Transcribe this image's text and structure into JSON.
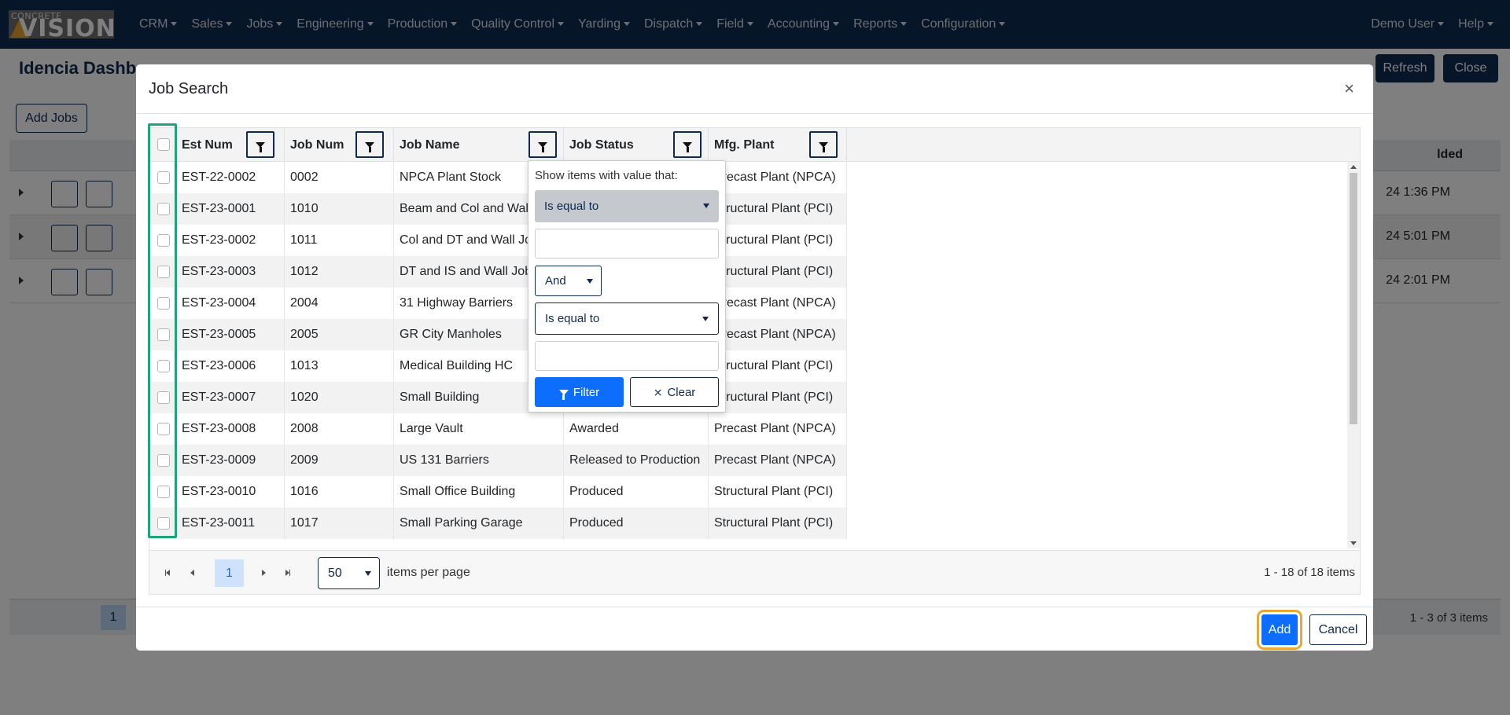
{
  "app": {
    "logo_small": "CONCRETE",
    "logo_big": "VISION"
  },
  "nav": {
    "items": [
      {
        "label": "CRM"
      },
      {
        "label": "Sales"
      },
      {
        "label": "Jobs"
      },
      {
        "label": "Engineering"
      },
      {
        "label": "Production"
      },
      {
        "label": "Quality Control"
      },
      {
        "label": "Yarding"
      },
      {
        "label": "Dispatch"
      },
      {
        "label": "Field"
      },
      {
        "label": "Accounting"
      },
      {
        "label": "Reports"
      },
      {
        "label": "Configuration"
      }
    ],
    "user": "Demo User",
    "help": "Help"
  },
  "background": {
    "title": "Idencia Dashb",
    "refresh_label": "Refresh",
    "close_label": "Close",
    "add_jobs_label": "Add Jobs",
    "header_fragment": "lded",
    "rows": [
      {
        "time": "24 1:36 PM"
      },
      {
        "time": "24 5:01 PM"
      },
      {
        "time": "24 2:01 PM"
      }
    ],
    "pager_page": "1",
    "pager_info": "1 - 3 of 3 items"
  },
  "modal": {
    "title": "Job Search",
    "close_glyph": "×",
    "columns": [
      "Est Num",
      "Job Num",
      "Job Name",
      "Job Status",
      "Mfg. Plant"
    ],
    "rows": [
      {
        "est": "EST-22-0002",
        "job": "0002",
        "name": "NPCA Plant Stock",
        "status": "",
        "plant": "Precast Plant (NPCA)"
      },
      {
        "est": "EST-23-0001",
        "job": "1010",
        "name": "Beam and Col and Wall",
        "status": "",
        "plant": "Structural Plant (PCI)"
      },
      {
        "est": "EST-23-0002",
        "job": "1011",
        "name": "Col and DT and Wall Job",
        "status": "",
        "plant": "Structural Plant (PCI)"
      },
      {
        "est": "EST-23-0003",
        "job": "1012",
        "name": "DT and IS and Wall Job",
        "status": "",
        "plant": "Structural Plant (PCI)"
      },
      {
        "est": "EST-23-0004",
        "job": "2004",
        "name": "31 Highway Barriers",
        "status": "",
        "plant": "Precast Plant (NPCA)"
      },
      {
        "est": "EST-23-0005",
        "job": "2005",
        "name": "GR City Manholes",
        "status": "",
        "plant": "Precast Plant (NPCA)"
      },
      {
        "est": "EST-23-0006",
        "job": "1013",
        "name": "Medical Building HC",
        "status": "",
        "plant": "Structural Plant (PCI)"
      },
      {
        "est": "EST-23-0007",
        "job": "1020",
        "name": "Small Building",
        "status": "",
        "plant": "Structural Plant (PCI)"
      },
      {
        "est": "EST-23-0008",
        "job": "2008",
        "name": "Large Vault",
        "status": "Awarded",
        "plant": "Precast Plant (NPCA)"
      },
      {
        "est": "EST-23-0009",
        "job": "2009",
        "name": "US 131 Barriers",
        "status": "Released to Production",
        "plant": "Precast Plant (NPCA)"
      },
      {
        "est": "EST-23-0010",
        "job": "1016",
        "name": "Small Office Building",
        "status": "Produced",
        "plant": "Structural Plant (PCI)"
      },
      {
        "est": "EST-23-0011",
        "job": "1017",
        "name": "Small Parking Garage",
        "status": "Produced",
        "plant": "Structural Plant (PCI)"
      }
    ],
    "pager": {
      "page": "1",
      "page_size": "50",
      "items_per_page_label": "items per page",
      "info": "1 - 18 of 18 items"
    },
    "filter_popup": {
      "label": "Show items with value that:",
      "operator1": "Is equal to",
      "logic": "And",
      "operator2": "Is equal to",
      "filter_label": "Filter",
      "clear_label": "Clear"
    },
    "add_label": "Add",
    "cancel_label": "Cancel"
  },
  "colors": {
    "navbar": "#0e2a52",
    "primary": "#0d6efd",
    "highlight_green": "#1fa37a",
    "highlight_orange": "#e8a838"
  }
}
